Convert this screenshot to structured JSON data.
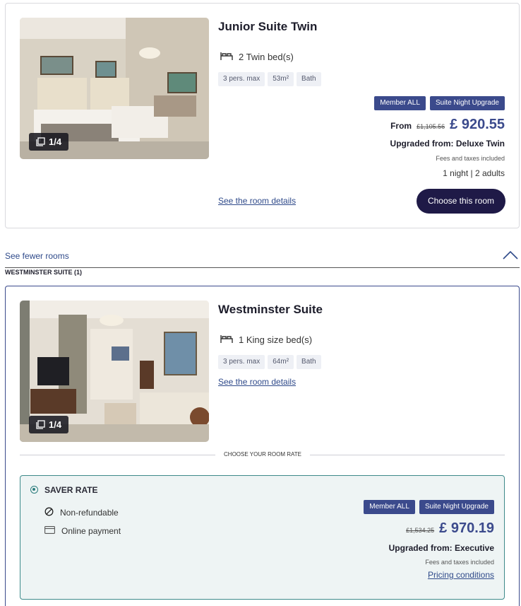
{
  "room1": {
    "title": "Junior Suite Twin",
    "beds": "2 Twin bed(s)",
    "tags": [
      "3 pers. max",
      "53m²",
      "Bath"
    ],
    "photo_counter": "1/4",
    "details_link": "See the room details",
    "badges": [
      "Member ALL",
      "Suite Night Upgrade"
    ],
    "price_from": "From",
    "price_old": "£1,105.56",
    "price_new": "£ 920.55",
    "upgraded_from": "Upgraded from: Deluxe Twin",
    "fees": "Fees and taxes included",
    "stay": "1 night | 2 adults",
    "choose_label": "Choose this room"
  },
  "see_fewer": "See fewer rooms",
  "section_label": "WESTMINSTER SUITE (1)",
  "room2": {
    "title": "Westminster Suite",
    "beds": "1 King size bed(s)",
    "tags": [
      "3 pers. max",
      "64m²",
      "Bath"
    ],
    "photo_counter": "1/4",
    "details_link": "See the room details",
    "rate_heading": "CHOOSE YOUR ROOM RATE",
    "rate": {
      "name": "SAVER RATE",
      "features": [
        "Non-refundable",
        "Online payment"
      ],
      "badges": [
        "Member ALL",
        "Suite Night Upgrade"
      ],
      "price_old": "£1,534.25",
      "price_new": "£ 970.19",
      "upgraded_from": "Upgraded from: Executive",
      "fees": "Fees and taxes included",
      "pricing_link": "Pricing conditions"
    }
  },
  "colors": {
    "brand": "#3b4a8c",
    "button": "#1f1a47",
    "rate_border": "#3d8a8a",
    "rate_bg": "#eef4f4"
  }
}
